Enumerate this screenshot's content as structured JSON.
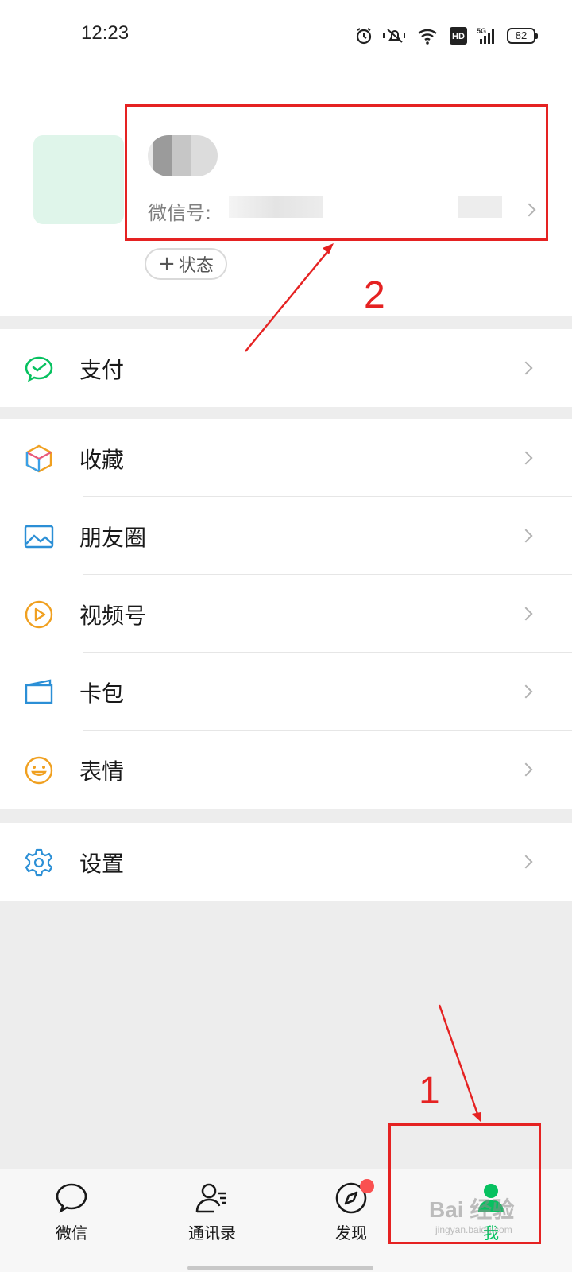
{
  "status_bar": {
    "time": "12:23",
    "battery": "82",
    "network_label": "5G",
    "hd_label": "HD",
    "icons": [
      "alarm-icon",
      "mute-icon",
      "wifi-icon",
      "hd-icon",
      "signal-icon",
      "battery-icon"
    ]
  },
  "profile": {
    "wechat_id_label": "微信号:",
    "status_button_label": "状态"
  },
  "menu": {
    "pay": {
      "label": "支付",
      "icon": "wechat-pay-icon"
    },
    "favorites": {
      "label": "收藏",
      "icon": "cube-icon"
    },
    "moments": {
      "label": "朋友圈",
      "icon": "image-icon"
    },
    "channels": {
      "label": "视频号",
      "icon": "play-icon"
    },
    "cards": {
      "label": "卡包",
      "icon": "wallet-icon"
    },
    "stickers": {
      "label": "表情",
      "icon": "smiley-icon"
    },
    "settings": {
      "label": "设置",
      "icon": "gear-icon"
    }
  },
  "tabs": [
    {
      "label": "微信",
      "icon": "chat-bubble-icon"
    },
    {
      "label": "通讯录",
      "icon": "contacts-icon"
    },
    {
      "label": "发现",
      "icon": "compass-icon",
      "badge": true
    },
    {
      "label": "我",
      "icon": "person-icon",
      "active": true
    }
  ],
  "annotations": {
    "one": "1",
    "two": "2"
  },
  "watermark": {
    "text": "Bai 经验",
    "sub": "jingyan.baidu.com"
  },
  "colors": {
    "accent_green": "#07c160",
    "annotation_red": "#e52222",
    "badge_red": "#fa5151"
  }
}
